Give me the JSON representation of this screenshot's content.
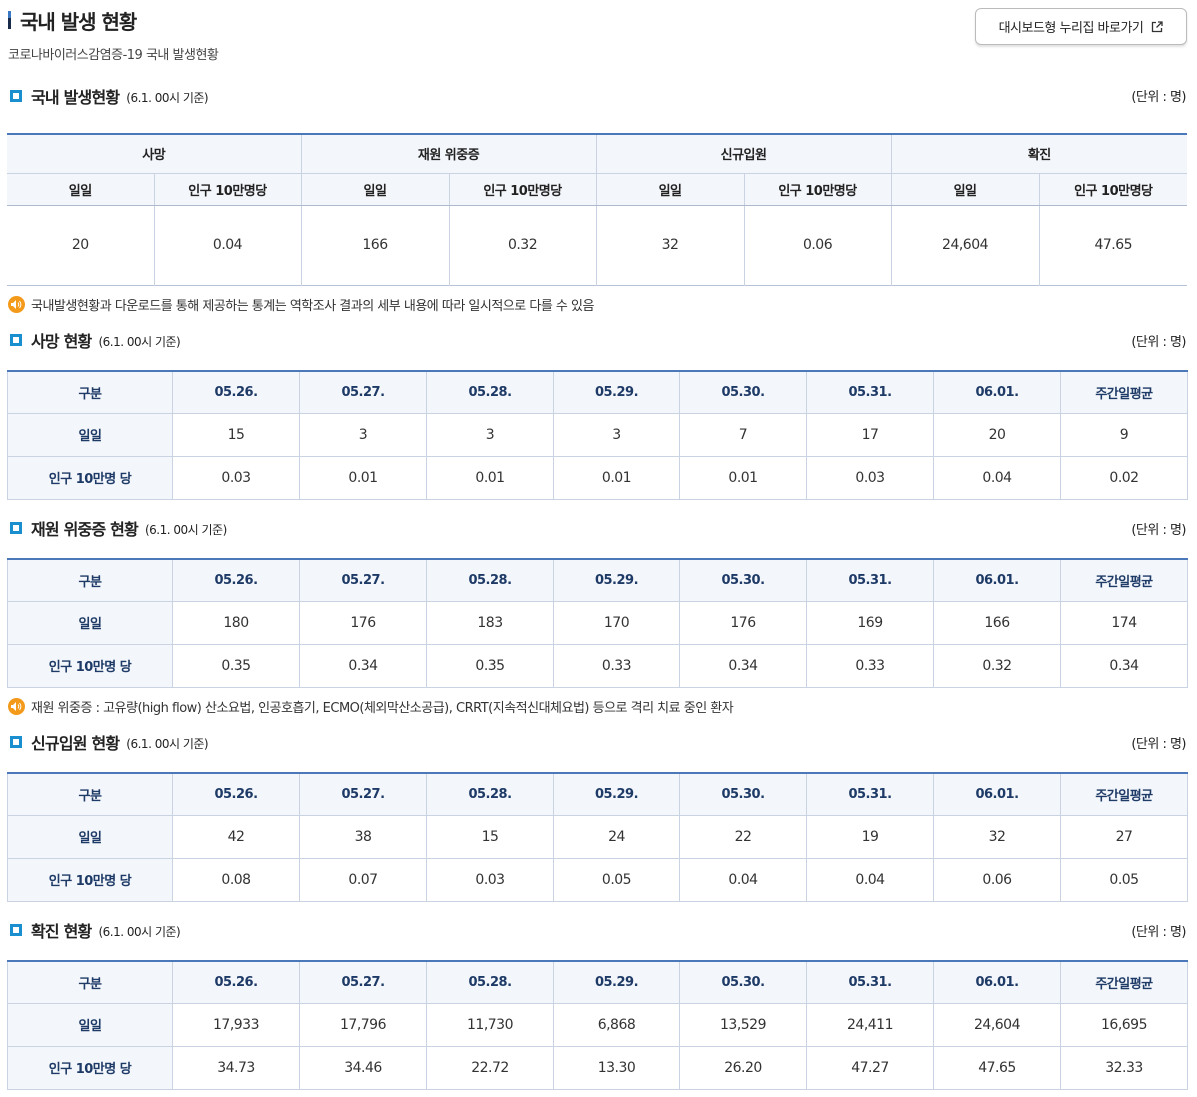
{
  "header": {
    "title": "국내 발생 현황",
    "subtitle": "코로나바이러스감염증-19 국내 발생현황",
    "dashboard_button": "대시보드형 누리집 바로가기"
  },
  "summary": {
    "title": "국내 발생현황",
    "date": "(6.1. 00시 기준)",
    "unit": "(단위 : 명)",
    "groups": [
      "사망",
      "재원 위중증",
      "신규입원",
      "확진"
    ],
    "sub_daily": "일일",
    "sub_per100k": "인구 10만명당",
    "values": [
      "20",
      "0.04",
      "166",
      "0.32",
      "32",
      "0.06",
      "24,604",
      "47.65"
    ],
    "note": "국내발생현황과 다운로드를 통해 제공하는 통계는 역학조사 결과의 세부 내용에 따라 일시적으로 다를 수 있음"
  },
  "columns": [
    "구분",
    "05.26.",
    "05.27.",
    "05.28.",
    "05.29.",
    "05.30.",
    "05.31.",
    "06.01.",
    "주간일평균"
  ],
  "row_daily": "일일",
  "row_per100k": "인구 10만명 당",
  "death": {
    "title": "사망 현황",
    "date": "(6.1. 00시 기준)",
    "unit": "(단위 : 명)",
    "daily": [
      "15",
      "3",
      "3",
      "3",
      "7",
      "17",
      "20",
      "9"
    ],
    "per100k": [
      "0.03",
      "0.01",
      "0.01",
      "0.01",
      "0.01",
      "0.03",
      "0.04",
      "0.02"
    ]
  },
  "severe": {
    "title": "재원 위중증 현황",
    "date": "(6.1. 00시 기준)",
    "unit": "(단위 : 명)",
    "daily": [
      "180",
      "176",
      "183",
      "170",
      "176",
      "169",
      "166",
      "174"
    ],
    "per100k": [
      "0.35",
      "0.34",
      "0.35",
      "0.33",
      "0.34",
      "0.33",
      "0.32",
      "0.34"
    ],
    "note": "재원 위중증 : 고유량(high flow) 산소요법, 인공호흡기, ECMO(체외막산소공급), CRRT(지속적신대체요법) 등으로 격리 치료 중인 환자"
  },
  "admission": {
    "title": "신규입원 현황",
    "date": "(6.1. 00시 기준)",
    "unit": "(단위 : 명)",
    "daily": [
      "42",
      "38",
      "15",
      "24",
      "22",
      "19",
      "32",
      "27"
    ],
    "per100k": [
      "0.08",
      "0.07",
      "0.03",
      "0.05",
      "0.04",
      "0.04",
      "0.06",
      "0.05"
    ]
  },
  "confirmed": {
    "title": "확진 현황",
    "date": "(6.1. 00시 기준)",
    "unit": "(단위 : 명)",
    "daily": [
      "17,933",
      "17,796",
      "11,730",
      "6,868",
      "13,529",
      "24,411",
      "24,604",
      "16,695"
    ],
    "per100k": [
      "34.73",
      "34.46",
      "22.72",
      "13.30",
      "26.20",
      "47.27",
      "47.65",
      "32.33"
    ]
  }
}
